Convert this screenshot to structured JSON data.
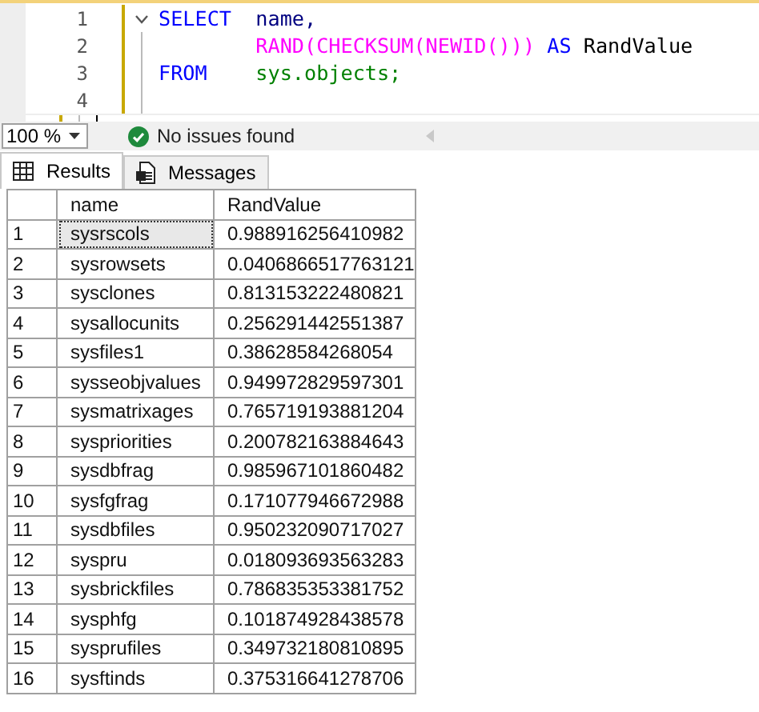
{
  "editor": {
    "lines": [
      {
        "number": "1",
        "foldable": true,
        "keyword": "SELECT",
        "tokens": [
          {
            "kind": "column",
            "text": "name,"
          }
        ]
      },
      {
        "number": "2",
        "foldable": false,
        "tokens": [
          {
            "kind": "function",
            "text": "RAND(CHECKSUM(NEWID()))"
          },
          {
            "kind": "keyword",
            "text": "AS"
          },
          {
            "kind": "plain",
            "text": "RandValue"
          }
        ]
      },
      {
        "number": "3",
        "foldable": false,
        "keyword": "FROM",
        "tokens": [
          {
            "kind": "object",
            "text": "sys.objects;"
          }
        ]
      },
      {
        "number": "4",
        "foldable": false
      }
    ]
  },
  "status_bar": {
    "zoom": "100 %",
    "message": "No issues found"
  },
  "tabs": [
    {
      "label": "Results",
      "selected": true
    },
    {
      "label": "Messages",
      "selected": false
    }
  ],
  "table": {
    "columns": [
      "name",
      "RandValue"
    ],
    "rows": [
      {
        "number": "1",
        "name": "sysrscols",
        "value": "0.988916256410982",
        "selected": true
      },
      {
        "number": "2",
        "name": "sysrowsets",
        "value": "0.0406866517763121",
        "selected": false
      },
      {
        "number": "3",
        "name": "sysclones",
        "value": "0.813153222480821",
        "selected": false
      },
      {
        "number": "4",
        "name": "sysallocunits",
        "value": "0.256291442551387",
        "selected": false
      },
      {
        "number": "5",
        "name": "sysfiles1",
        "value": "0.38628584268054",
        "selected": false
      },
      {
        "number": "6",
        "name": "sysseobjvalues",
        "value": "0.949972829597301",
        "selected": false
      },
      {
        "number": "7",
        "name": "sysmatrixages",
        "value": "0.765719193881204",
        "selected": false
      },
      {
        "number": "8",
        "name": "syspriorities",
        "value": "0.200782163884643",
        "selected": false
      },
      {
        "number": "9",
        "name": "sysdbfrag",
        "value": "0.985967101860482",
        "selected": false
      },
      {
        "number": "10",
        "name": "sysfgfrag",
        "value": "0.171077946672988",
        "selected": false
      },
      {
        "number": "11",
        "name": "sysdbfiles",
        "value": "0.950232090717027",
        "selected": false
      },
      {
        "number": "12",
        "name": "syspru",
        "value": "0.018093693563283",
        "selected": false
      },
      {
        "number": "13",
        "name": "sysbrickfiles",
        "value": "0.786835353381752",
        "selected": false
      },
      {
        "number": "14",
        "name": "sysphfg",
        "value": "0.101874928438578",
        "selected": false
      },
      {
        "number": "15",
        "name": "sysprufiles",
        "value": "0.349732180810895",
        "selected": false
      },
      {
        "number": "16",
        "name": "sysftinds",
        "value": "0.375316641278706",
        "selected": false
      }
    ]
  }
}
